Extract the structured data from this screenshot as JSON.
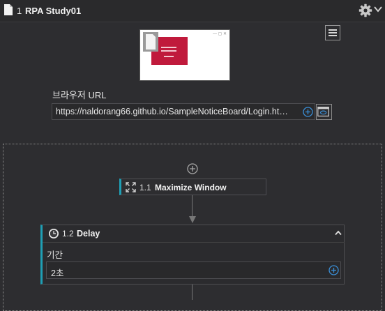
{
  "header": {
    "number": "1",
    "title": "RPA Study01",
    "icons": [
      "document-icon",
      "gear-icon",
      "chevron-down-icon"
    ]
  },
  "browser": {
    "url_label": "브라우저 URL",
    "url_value": "https://naldorang66.github.io/SampleNoticeBoard/Login.ht…"
  },
  "activities": [
    {
      "number": "1.1",
      "title": "Maximize Window",
      "icon": "maximize-icon"
    },
    {
      "number": "1.2",
      "title": "Delay",
      "icon": "clock-icon",
      "field_label": "기간",
      "field_value": "2초"
    }
  ],
  "colors": {
    "background": "#2d2d30",
    "accent": "#1f9fb5",
    "plus": "#3a8fd8",
    "thumbnail_red": "#c01a3c"
  }
}
